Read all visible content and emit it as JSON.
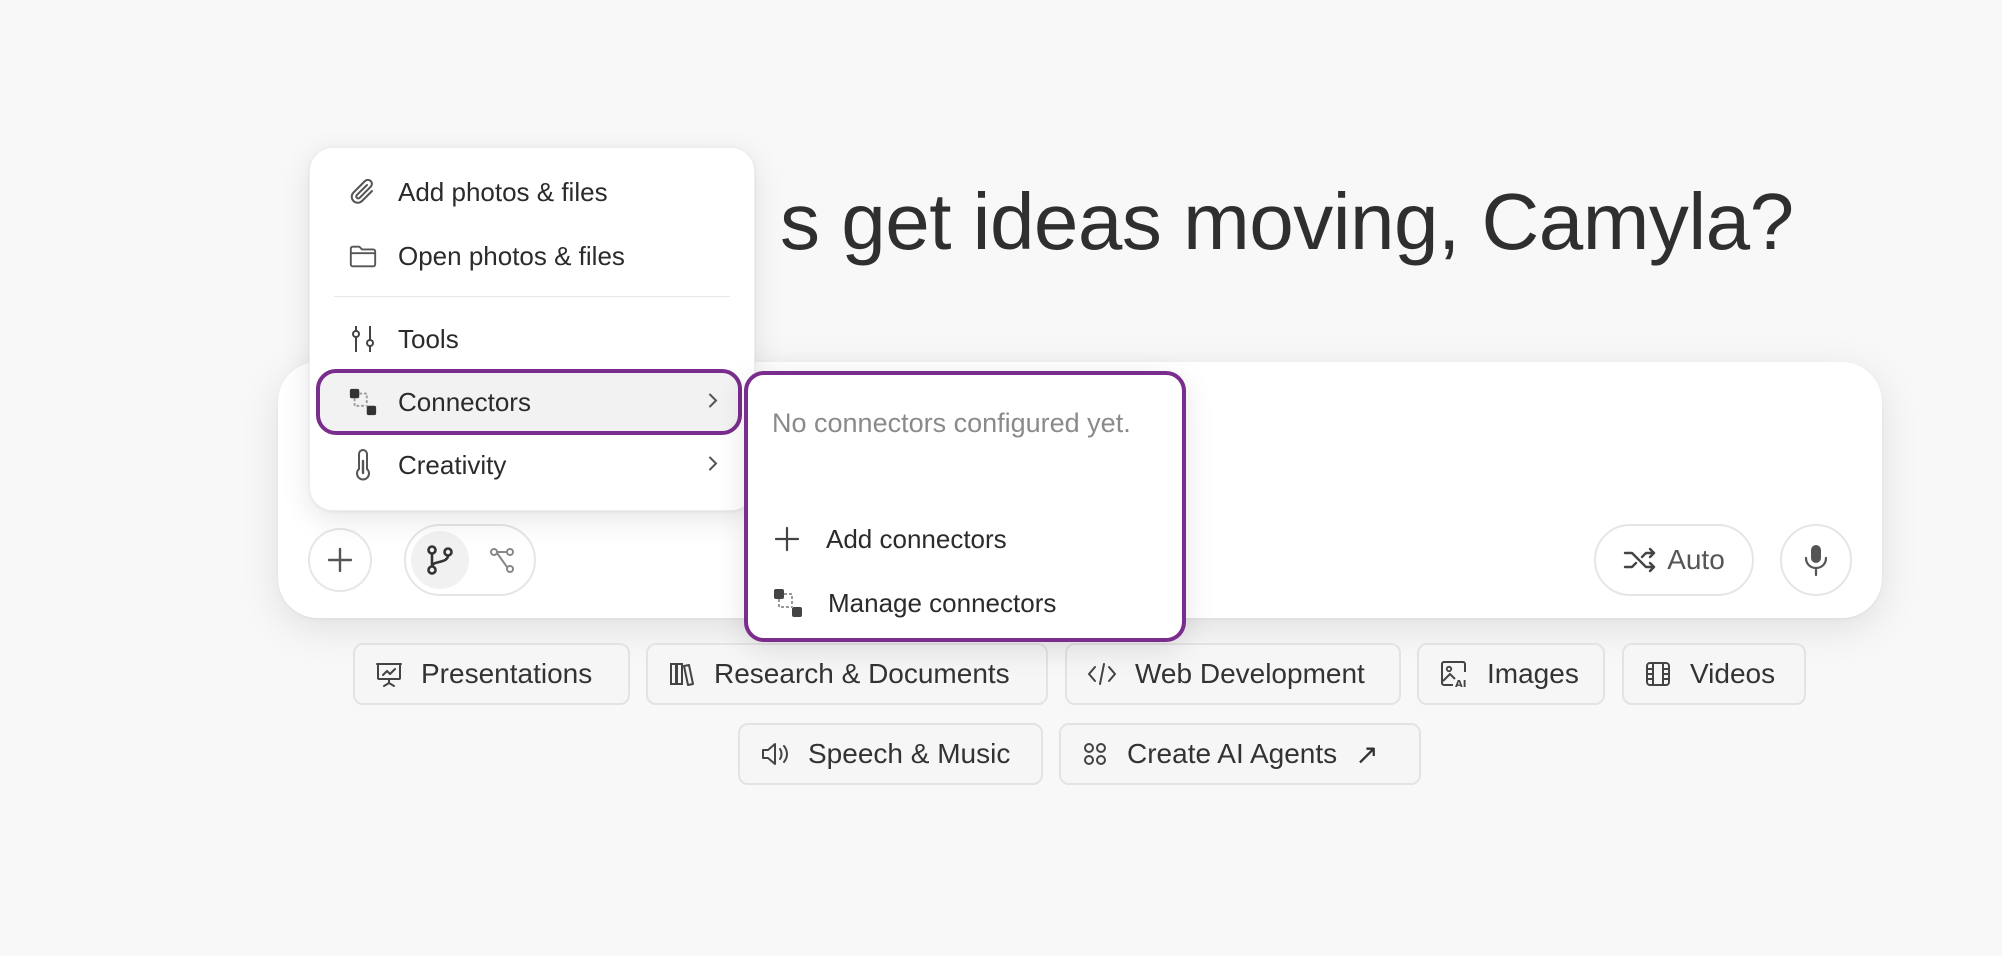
{
  "headline": "s get ideas moving, Camyla?",
  "composer": {
    "plus_icon": "plus-icon",
    "mode_toggle": [
      "branch-icon",
      "graph-icon"
    ],
    "model_label": "Auto",
    "mic_icon": "microphone-icon"
  },
  "attach_menu": {
    "items": [
      {
        "label": "Add photos & files",
        "icon": "paperclip-icon"
      },
      {
        "label": "Open photos & files",
        "icon": "folder-icon"
      },
      {
        "label": "Tools",
        "icon": "sliders-icon"
      },
      {
        "label": "Connectors",
        "icon": "connectors-icon",
        "has_submenu": true,
        "active": true
      },
      {
        "label": "Creativity",
        "icon": "thermometer-icon",
        "has_submenu": true
      }
    ]
  },
  "connectors_submenu": {
    "empty_text": "No connectors configured yet.",
    "add_label": "Add connectors",
    "manage_label": "Manage connectors"
  },
  "chips": [
    {
      "label": "Presentations",
      "icon": "presentation-icon"
    },
    {
      "label": "Research & Documents",
      "icon": "books-icon"
    },
    {
      "label": "Web Development",
      "icon": "code-icon"
    },
    {
      "label": "Images",
      "icon": "ai-image-icon"
    },
    {
      "label": "Videos",
      "icon": "film-icon"
    },
    {
      "label": "Speech & Music",
      "icon": "speaker-icon"
    },
    {
      "label": "Create AI Agents",
      "icon": "grid-dots-icon",
      "suffix": "↗"
    }
  ],
  "colors": {
    "accent_outline": "#7a2d8c",
    "background": "#f8f8f8"
  }
}
